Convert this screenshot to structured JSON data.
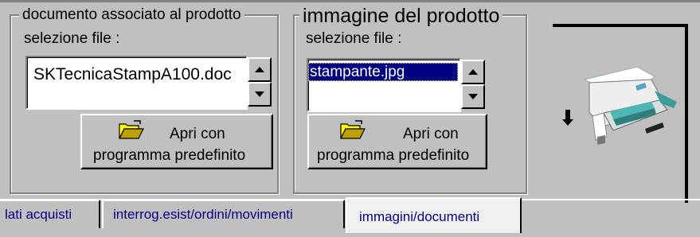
{
  "doc_group": {
    "legend": "documento associato al prodotto",
    "select_label": "selezione file :",
    "files": [
      "SKTecnicaStampA100.doc"
    ],
    "open_button": {
      "line1": "Apri con",
      "line2": "programma predefinito"
    }
  },
  "img_group": {
    "legend": "immagine del prodotto",
    "select_label": "selezione file :",
    "files": [
      "stampante.jpg"
    ],
    "selected_index": 0,
    "open_button": {
      "line1": "Apri con",
      "line2": "programma predefinito"
    }
  },
  "preview": {
    "icon": "printer-image"
  },
  "tabs": [
    {
      "label": "lati acquisti",
      "active": false
    },
    {
      "label": "interrog.esist/ordini/movimenti",
      "active": false
    },
    {
      "label": "immagini/documenti",
      "active": true
    }
  ],
  "colors": {
    "face": "#c0c0c0",
    "selection": "#000080",
    "tab_text": "#000080"
  }
}
